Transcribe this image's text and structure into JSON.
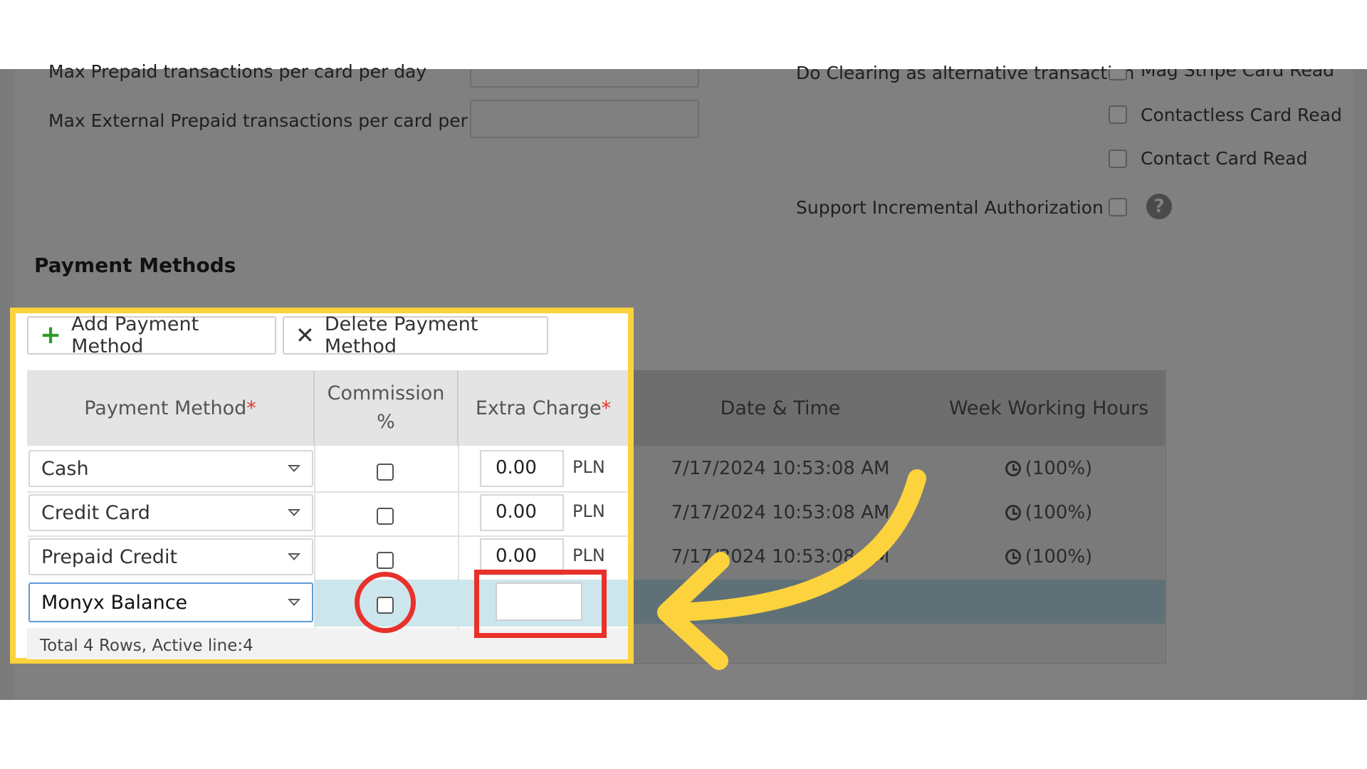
{
  "settings": {
    "max_prepaid_label": "Max Prepaid transactions per card per day",
    "max_external_prepaid_label": "Max External Prepaid transactions per card per day",
    "do_clearing_label": "Do Clearing as alternative transaction",
    "mag_stripe_label": "Mag Stripe Card Read",
    "contactless_label": "Contactless Card Read",
    "contact_label": "Contact Card Read",
    "incremental_auth_label": "Support Incremental Authorization",
    "help_glyph": "?"
  },
  "payment_methods": {
    "title": "Payment Methods",
    "toolbar": {
      "add_label": "Add Payment Method",
      "delete_label": "Delete Payment Method"
    },
    "columns": {
      "payment_method": "Payment Method",
      "commission_line1": "Commission",
      "commission_line2": "%",
      "extra_charge": "Extra Charge",
      "required_mark": "*",
      "date_time": "Date & Time",
      "week_hours": "Week Working Hours"
    },
    "rows": [
      {
        "method": "Cash",
        "extra": "0.00",
        "currency": "PLN",
        "datetime": "7/17/2024 10:53:08 AM",
        "hours": "(100%)"
      },
      {
        "method": "Credit Card",
        "extra": "0.00",
        "currency": "PLN",
        "datetime": "7/17/2024 10:53:08 AM",
        "hours": "(100%)"
      },
      {
        "method": "Prepaid Credit",
        "extra": "0.00",
        "currency": "PLN",
        "datetime": "7/17/2024 10:53:08 AM",
        "hours": "(100%)"
      },
      {
        "method": "Monyx Balance",
        "extra": "",
        "currency": "",
        "datetime": "",
        "hours": ""
      }
    ],
    "footer": "Total 4 Rows, Active line:4"
  },
  "colors": {
    "highlight_border": "#fcd23d",
    "annotation_red": "#e8312a",
    "arrow_yellow": "#fcd23d"
  }
}
